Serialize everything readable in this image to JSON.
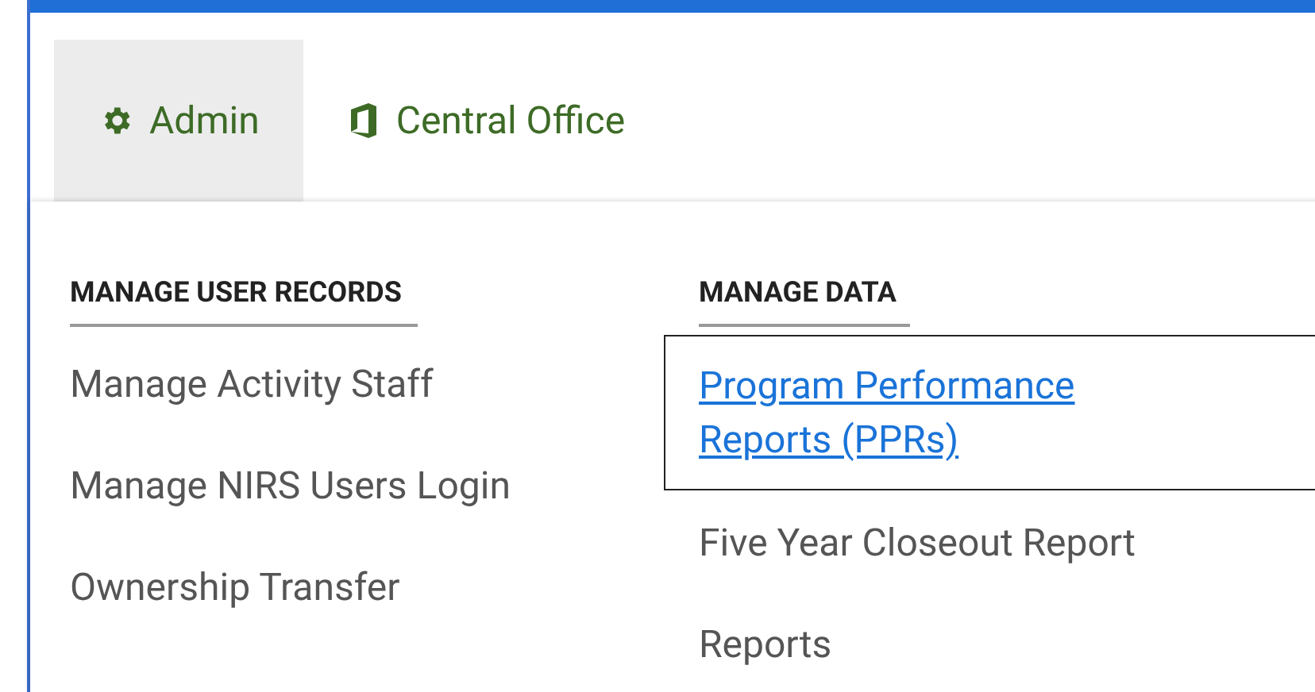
{
  "nav_tabs": [
    {
      "label": "Admin",
      "selected": true
    },
    {
      "label": "Central Office",
      "selected": false
    }
  ],
  "menu_columns": [
    {
      "heading": "MANAGE USER RECORDS",
      "items": [
        {
          "label": "Manage Activity Staff",
          "selected": false
        },
        {
          "label": "Manage NIRS Users Login",
          "selected": false
        },
        {
          "label": "Ownership Transfer",
          "selected": false
        }
      ]
    },
    {
      "heading": "MANAGE DATA",
      "items": [
        {
          "label": "Program Performance Reports (PPRs)",
          "selected": true
        },
        {
          "label": "Five Year Closeout Report",
          "selected": false
        },
        {
          "label": "Reports",
          "selected": false
        }
      ]
    }
  ]
}
